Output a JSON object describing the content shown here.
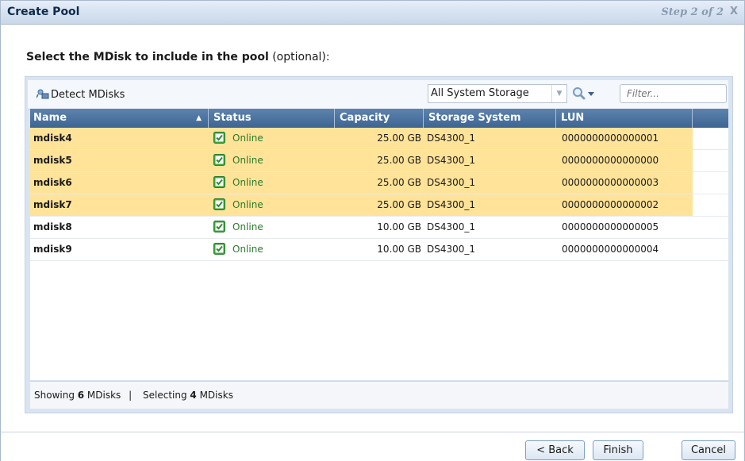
{
  "dialog": {
    "title": "Create Pool",
    "step": "Step 2 of 2",
    "close": "X"
  },
  "prompt": {
    "bold": "Select the MDisk to include in the pool",
    "rest": " (optional):"
  },
  "toolbar": {
    "detect_label": "Detect MDisks",
    "storage_select": "All System Storage",
    "filter_placeholder": "Filter..."
  },
  "table": {
    "columns": [
      "Name",
      "Status",
      "Capacity",
      "Storage System",
      "LUN"
    ],
    "rows": [
      {
        "name": "mdisk4",
        "status": "Online",
        "capacity": "25.00 GB",
        "storage": "DS4300_1",
        "lun": "0000000000000001",
        "selected": true
      },
      {
        "name": "mdisk5",
        "status": "Online",
        "capacity": "25.00 GB",
        "storage": "DS4300_1",
        "lun": "0000000000000000",
        "selected": true
      },
      {
        "name": "mdisk6",
        "status": "Online",
        "capacity": "25.00 GB",
        "storage": "DS4300_1",
        "lun": "0000000000000003",
        "selected": true
      },
      {
        "name": "mdisk7",
        "status": "Online",
        "capacity": "25.00 GB",
        "storage": "DS4300_1",
        "lun": "0000000000000002",
        "selected": true
      },
      {
        "name": "mdisk8",
        "status": "Online",
        "capacity": "10.00 GB",
        "storage": "DS4300_1",
        "lun": "0000000000000005",
        "selected": false
      },
      {
        "name": "mdisk9",
        "status": "Online",
        "capacity": "10.00 GB",
        "storage": "DS4300_1",
        "lun": "0000000000000004",
        "selected": false
      }
    ]
  },
  "footer": {
    "showing_pre": "Showing ",
    "showing_count": "6",
    "showing_post": " MDisks",
    "separator": "|",
    "selecting_pre": "Selecting ",
    "selecting_count": "4",
    "selecting_post": " MDisks"
  },
  "buttons": {
    "back": "< Back",
    "finish": "Finish",
    "cancel": "Cancel"
  },
  "colors": {
    "header": "#4a7099",
    "selected_row": "#fee398",
    "online_check": "#3ca53c"
  }
}
